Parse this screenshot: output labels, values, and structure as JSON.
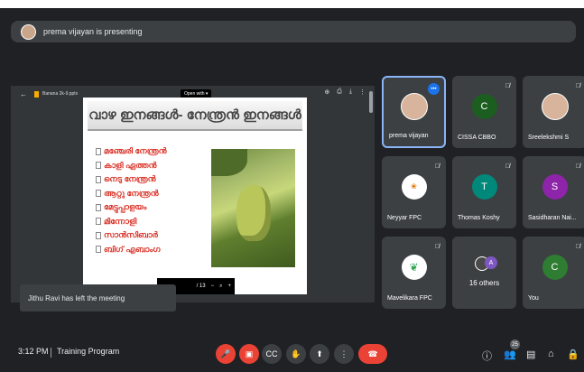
{
  "banner": {
    "text": "prema vijayan is presenting"
  },
  "presentation": {
    "file_name": "Banana 2k-9.pptx",
    "open_with": "Open with ▾",
    "slide_title": "വാഴ ഇനങ്ങൾ- നേന്ത്രൻ ഇനങ്ങൾ",
    "bullets": [
      "മഞ്ചേരി നേന്ത്രൻ",
      "കാളി ഏത്തൻ",
      "നെടു നേന്ത്രൻ",
      "ആറ്റു നേന്ത്രൻ",
      "മേട്ടുപ്പാളയം",
      "മിന്നോളി",
      "സാൻസിബാർ",
      "ബിഗ് എബാംഗ"
    ],
    "pager": "/ 13"
  },
  "toast": "Jithu Ravi has left the meeting",
  "tiles": [
    {
      "name": "prema vijayan"
    },
    {
      "name": "CISSA CBBO",
      "initial": "C",
      "color": "#1b5e20"
    },
    {
      "name": "Sreelekshmi S"
    },
    {
      "name": "Neyyar FPC"
    },
    {
      "name": "Thomas Koshy",
      "initial": "T",
      "color": "#00897b"
    },
    {
      "name": "Sasidharan Nai...",
      "initial": "S",
      "color": "#8e24aa"
    },
    {
      "name": "Mavelikara FPC"
    },
    {
      "name": "16 others",
      "initial": "A"
    },
    {
      "name": "You",
      "initial": "C",
      "color": "#2e7d32"
    }
  ],
  "bottom": {
    "time": "3:12 PM",
    "meeting": "Training Program",
    "participants_count": "25"
  }
}
